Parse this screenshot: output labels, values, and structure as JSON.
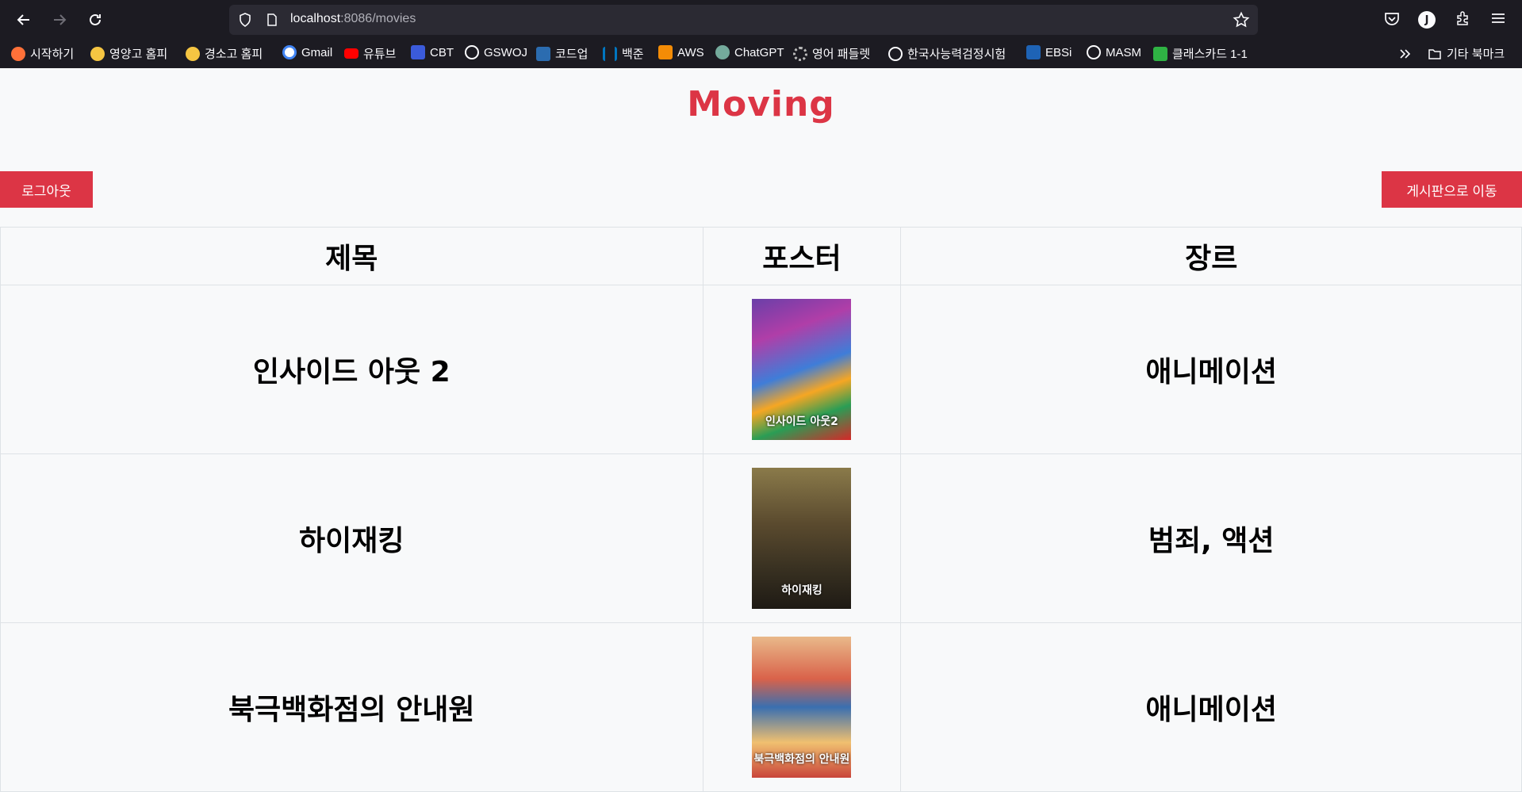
{
  "browser": {
    "url_host": "localhost",
    "url_rest": ":8086/movies",
    "avatar_letter": "J",
    "bookmarks": [
      {
        "label": "시작하기",
        "icon": "firefox-icon",
        "color": "#ff7139"
      },
      {
        "label": "영양고 홈피",
        "icon": "school-mascot-icon",
        "color": "#f5c542"
      },
      {
        "label": "경소고 홈피",
        "icon": "school-mascot-icon",
        "color": "#f5c542"
      },
      {
        "label": "Gmail",
        "icon": "google-icon",
        "color": "#4285f4"
      },
      {
        "label": "유튜브",
        "icon": "youtube-icon",
        "color": "#ff0000"
      },
      {
        "label": "CBT",
        "icon": "cbt-icon",
        "color": "#3b5bdb"
      },
      {
        "label": "GSWOJ",
        "icon": "globe-icon",
        "color": "#fbfbfe"
      },
      {
        "label": "코드업",
        "icon": "codeup-icon",
        "color": "#2b6cb0"
      },
      {
        "label": "백준",
        "icon": "baekjoon-icon",
        "color": "#0076c0"
      },
      {
        "label": "AWS",
        "icon": "aws-icon",
        "color": "#f48c06"
      },
      {
        "label": "ChatGPT",
        "icon": "chatgpt-icon",
        "color": "#74aa9c"
      },
      {
        "label": "영어 패들렛",
        "icon": "gear-icon",
        "color": "#bbbbbb"
      },
      {
        "label": "한국사능력검정시험",
        "icon": "globe-icon",
        "color": "#fbfbfe"
      },
      {
        "label": "EBSi",
        "icon": "ebsi-icon",
        "color": "#1e63b5"
      },
      {
        "label": "MASM",
        "icon": "globe-icon",
        "color": "#fbfbfe"
      },
      {
        "label": "클래스카드 1-1",
        "icon": "classcard-icon",
        "color": "#2fb344"
      }
    ],
    "other_bookmarks": "기타 북마크"
  },
  "page": {
    "title": "Moving",
    "logout_label": "로그아웃",
    "board_label": "게시판으로 이동",
    "accent": "#dc3545"
  },
  "table": {
    "headers": [
      "제목",
      "포스터",
      "장르"
    ],
    "rows": [
      {
        "title": "인사이드 아웃 2",
        "poster_text": "인사이드 아웃2",
        "genre": "애니메이션"
      },
      {
        "title": "하이재킹",
        "poster_text": "하이재킹",
        "genre": "범죄, 액션"
      },
      {
        "title": "북극백화점의 안내원",
        "poster_text": "북극백화점의 안내원",
        "genre": "애니메이션"
      }
    ]
  }
}
